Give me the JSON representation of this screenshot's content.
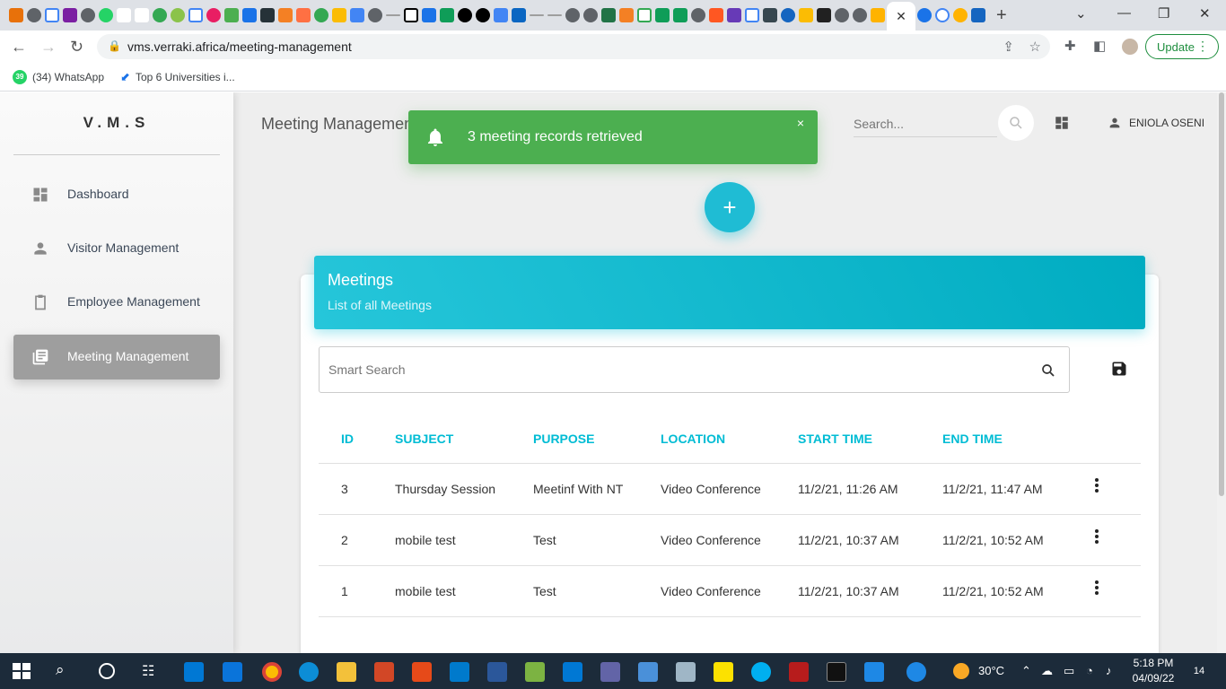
{
  "browser": {
    "url": "vms.verraki.africa/meeting-management",
    "update_label": "Update",
    "bookmarks": [
      {
        "label": "(34) WhatsApp",
        "badge": "39"
      },
      {
        "label": "Top 6 Universities i..."
      }
    ]
  },
  "sidebar": {
    "brand": "V.M.S",
    "items": [
      {
        "label": "Dashboard"
      },
      {
        "label": "Visitor Management"
      },
      {
        "label": "Employee Management"
      },
      {
        "label": "Meeting Management"
      }
    ]
  },
  "header": {
    "title": "Meeting Management",
    "search_placeholder": "Search...",
    "user_name": "ENIOLA OSENI"
  },
  "toast": {
    "message": "3 meeting records retrieved",
    "close": "×"
  },
  "fab": {
    "label": "+"
  },
  "card": {
    "title": "Meetings",
    "subtitle": "List of all Meetings",
    "smart_search_placeholder": "Smart Search"
  },
  "table": {
    "headers": [
      "ID",
      "SUBJECT",
      "PURPOSE",
      "LOCATION",
      "START TIME",
      "END TIME"
    ],
    "rows": [
      [
        "3",
        "Thursday Session",
        "Meetinf With NT",
        "Video Conference",
        "11/2/21, 11:26 AM",
        "11/2/21, 11:47 AM"
      ],
      [
        "2",
        "mobile test",
        "Test",
        "Video Conference",
        "11/2/21, 10:37 AM",
        "11/2/21, 10:52 AM"
      ],
      [
        "1",
        "mobile test",
        "Test",
        "Video Conference",
        "11/2/21, 10:37 AM",
        "11/2/21, 10:52 AM"
      ]
    ]
  },
  "taskbar": {
    "temperature": "30°C",
    "time": "5:18 PM",
    "date": "04/09/22",
    "notifications": "14"
  },
  "colors": {
    "accent": "#00bcd4",
    "success": "#4caf50",
    "sidebar_active": "#9e9e9e"
  }
}
